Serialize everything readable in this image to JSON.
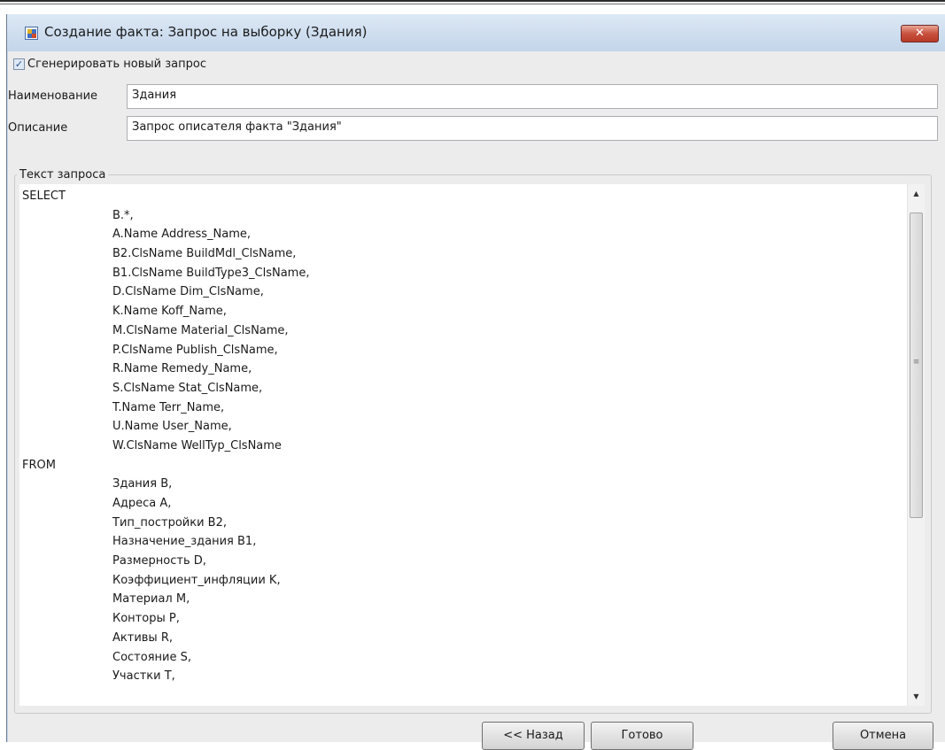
{
  "window": {
    "title": "Создание факта: Запрос на выборку (Здания)",
    "close_glyph": "✕"
  },
  "options": {
    "generate_new_query": {
      "label": "Сгенерировать новый запрос",
      "checked": true,
      "glyph": "✓"
    }
  },
  "form": {
    "name_label": "Наименование",
    "name_value": "Здания",
    "description_label": "Описание",
    "description_value": "Запрос описателя факта \"Здания\""
  },
  "query": {
    "group_label": "Текст запроса",
    "lines": [
      {
        "text": "SELECT",
        "indent": false
      },
      {
        "text": "B.*,",
        "indent": true
      },
      {
        "text": "A.Name Address_Name,",
        "indent": true
      },
      {
        "text": "B2.ClsName BuildMdl_ClsName,",
        "indent": true
      },
      {
        "text": "B1.ClsName BuildType3_ClsName,",
        "indent": true
      },
      {
        "text": "D.ClsName Dim_ClsName,",
        "indent": true
      },
      {
        "text": "K.Name Koff_Name,",
        "indent": true
      },
      {
        "text": "M.ClsName Material_ClsName,",
        "indent": true
      },
      {
        "text": "P.ClsName Publish_ClsName,",
        "indent": true
      },
      {
        "text": "R.Name Remedy_Name,",
        "indent": true
      },
      {
        "text": "S.ClsName Stat_ClsName,",
        "indent": true
      },
      {
        "text": "T.Name Terr_Name,",
        "indent": true
      },
      {
        "text": "U.Name User_Name,",
        "indent": true
      },
      {
        "text": "W.ClsName WellTyp_ClsName",
        "indent": true
      },
      {
        "text": "FROM",
        "indent": false
      },
      {
        "text": "Здания B,",
        "indent": true
      },
      {
        "text": "Адреса A,",
        "indent": true
      },
      {
        "text": "Тип_постройки B2,",
        "indent": true
      },
      {
        "text": "Назначение_здания B1,",
        "indent": true
      },
      {
        "text": "Размерность D,",
        "indent": true
      },
      {
        "text": "Коэффициент_инфляции K,",
        "indent": true
      },
      {
        "text": "Материал M,",
        "indent": true
      },
      {
        "text": "Конторы P,",
        "indent": true
      },
      {
        "text": "Активы R,",
        "indent": true
      },
      {
        "text": "Состояние S,",
        "indent": true
      },
      {
        "text": "Участки T,",
        "indent": true
      }
    ],
    "scroll": {
      "up_glyph": "▲",
      "down_glyph": "▼",
      "grip_glyph": "≡"
    }
  },
  "buttons": {
    "back": "<< Назад",
    "done": "Готово",
    "cancel": "Отмена"
  },
  "colors": {
    "frame": "#c9daee",
    "client": "#ececec",
    "close_button": "#c8513d"
  }
}
